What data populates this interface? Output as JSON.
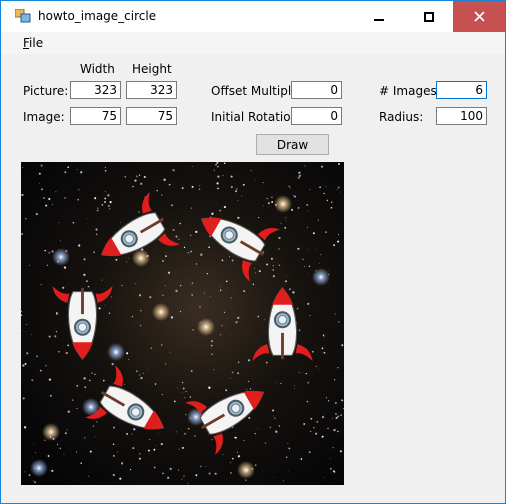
{
  "window": {
    "title": "howto_image_circle",
    "menu": {
      "file": "File",
      "file_rest": "ile",
      "file_accel": "F"
    }
  },
  "columns": {
    "width": "Width",
    "height": "Height"
  },
  "rows": {
    "picture": "Picture:",
    "image": "Image:"
  },
  "fields": {
    "picture_width": "323",
    "picture_height": "323",
    "image_width": "75",
    "image_height": "75",
    "offset_multiple": "0",
    "initial_rotation": "0",
    "num_images": "6",
    "radius": "100"
  },
  "labels": {
    "offset_multiple": "Offset Multiple:",
    "initial_rotation": "Initial Rotation:",
    "num_images": "# Images:",
    "radius": "Radius:"
  },
  "buttons": {
    "draw": "Draw"
  },
  "colors": {
    "accent": "#1883d7",
    "close": "#c75050",
    "rocket_red": "#e01e1e",
    "space": "#0a0a0c"
  },
  "icons": {
    "minimize": "minimize-icon",
    "maximize": "maximize-icon",
    "close": "close-icon",
    "app": "app-icon"
  }
}
